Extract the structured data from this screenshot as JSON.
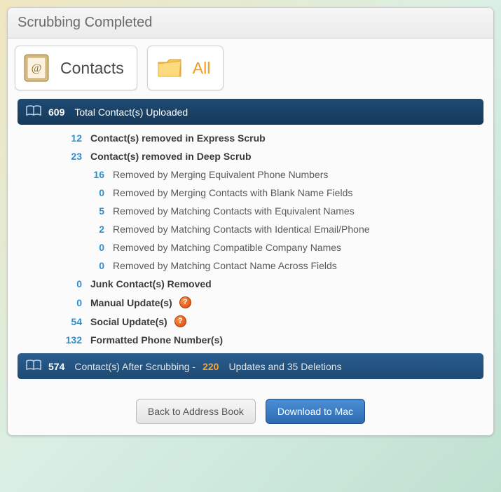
{
  "header": {
    "title": "Scrubbing Completed"
  },
  "tabs": {
    "contacts": {
      "label": "Contacts"
    },
    "all": {
      "label": "All"
    }
  },
  "total_bar": {
    "count": "609",
    "label": "Total Contact(s) Uploaded"
  },
  "rows": {
    "express": {
      "n": "12",
      "t": "Contact(s) removed in Express Scrub"
    },
    "deep": {
      "n": "23",
      "t": "Contact(s) removed in Deep Scrub"
    },
    "sub_phone": {
      "n": "16",
      "t": "Removed by Merging Equivalent Phone Numbers"
    },
    "sub_blank": {
      "n": "0",
      "t": "Removed by Merging Contacts with Blank Name Fields"
    },
    "sub_names": {
      "n": "5",
      "t": "Removed by Matching Contacts with Equivalent Names"
    },
    "sub_email": {
      "n": "2",
      "t": "Removed by Matching Contacts with Identical Email/Phone"
    },
    "sub_comp": {
      "n": "0",
      "t": "Removed by Matching Compatible Company Names"
    },
    "sub_cross": {
      "n": "0",
      "t": "Removed by Matching Contact Name Across Fields"
    },
    "junk": {
      "n": "0",
      "t": "Junk Contact(s) Removed"
    },
    "manual": {
      "n": "0",
      "t": "Manual Update(s)"
    },
    "social": {
      "n": "54",
      "t": "Social Update(s)"
    },
    "formatted": {
      "n": "132",
      "t": "Formatted Phone Number(s)"
    }
  },
  "after_bar": {
    "count": "574",
    "label1": "Contact(s) After Scrubbing - ",
    "updates": "220",
    "label2": "Updates and 35 Deletions"
  },
  "buttons": {
    "back": "Back to Address Book",
    "download": "Download to Mac"
  },
  "glyphs": {
    "help": "?"
  }
}
